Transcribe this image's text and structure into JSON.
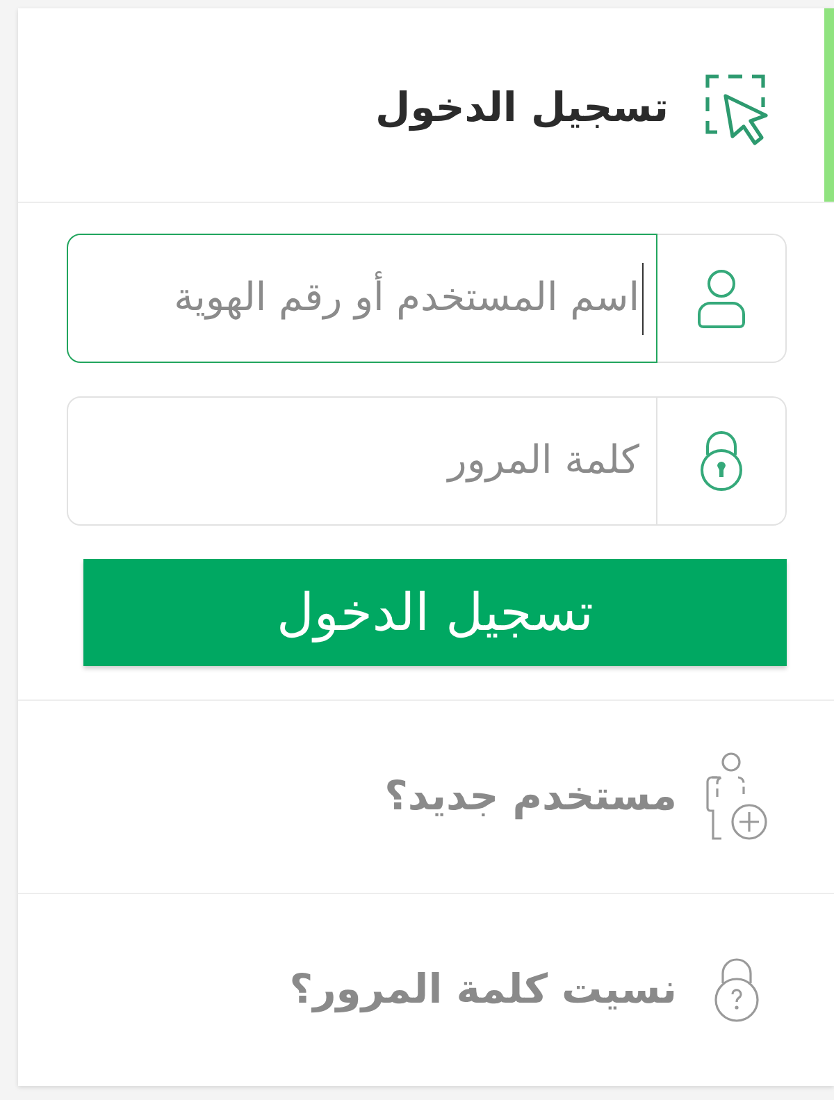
{
  "header": {
    "title": "تسجيل الدخول"
  },
  "fields": [
    {
      "kind": "username",
      "placeholder": "اسم المستخدم أو رقم الهوية",
      "focused": true
    },
    {
      "kind": "password",
      "placeholder": "كلمة المرور",
      "focused": false
    }
  ],
  "submit": {
    "label": "تسجيل الدخول"
  },
  "links": [
    {
      "kind": "register",
      "label": "مستخدم جديد؟"
    },
    {
      "kind": "forgot-password",
      "label": "نسيت كلمة المرور؟"
    }
  ]
}
